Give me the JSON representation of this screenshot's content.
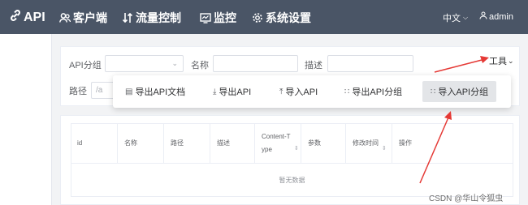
{
  "header": {
    "logo": "API",
    "nav": [
      {
        "label": "客户端",
        "icon": "users-icon"
      },
      {
        "label": "流量控制",
        "icon": "sort-arrows-icon"
      },
      {
        "label": "监控",
        "icon": "monitor-icon"
      },
      {
        "label": "系统设置",
        "icon": "gear-icon"
      }
    ],
    "language": "中文",
    "user": "admin"
  },
  "filters": {
    "group_label": "API分组",
    "name_label": "名称",
    "desc_label": "描述",
    "path_label": "路径",
    "path_placeholder": "/a",
    "tools_label": "工具"
  },
  "tools_menu": {
    "items": [
      {
        "label": "导出API文档",
        "icon": "document-icon"
      },
      {
        "label": "导出API",
        "icon": "download-icon"
      },
      {
        "label": "导入API",
        "icon": "upload-icon"
      },
      {
        "label": "导出API分组",
        "icon": "grid-icon"
      },
      {
        "label": "导入API分组",
        "icon": "grid-icon"
      }
    ],
    "highlighted": "导入API分组"
  },
  "table": {
    "columns": [
      "id",
      "名称",
      "路径",
      "描述",
      "Content-Type",
      "参数",
      "修改时间",
      "操作"
    ],
    "empty_text": "暂无数据"
  },
  "watermark": "CSDN @华山令狐虫",
  "colors": {
    "topbar": "#4a5566",
    "arrow": "#e53935",
    "highlight": "#e3e5e8"
  }
}
